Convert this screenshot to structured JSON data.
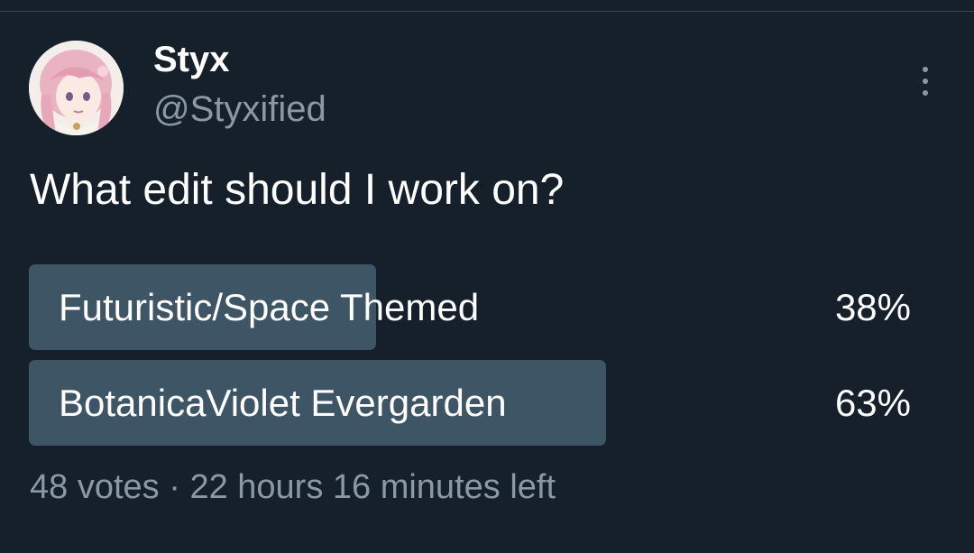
{
  "colors": {
    "background": "#15202b",
    "primary_text": "#ffffff",
    "secondary_text": "#8b98a5",
    "poll_bar": "#3e5566",
    "divider": "#38444d"
  },
  "author": {
    "display_name": "Styx",
    "handle": "@Styxified",
    "avatar_icon": "anime-character-avatar"
  },
  "menu": {
    "icon": "more-vertical-icon"
  },
  "tweet": {
    "text": "What edit should I work on?"
  },
  "poll": {
    "options": [
      {
        "label": "Futuristic/Space Themed",
        "percent_label": "38%",
        "fill": 0.385
      },
      {
        "label": "BotanicaViolet Evergarden",
        "percent_label": "63%",
        "fill": 0.64
      }
    ],
    "votes": "48 votes",
    "separator": "·",
    "time_left": "22 hours 16 minutes left"
  }
}
